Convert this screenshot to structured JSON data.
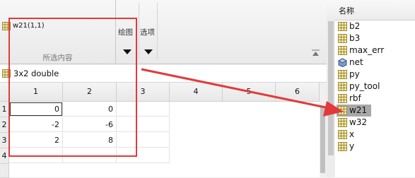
{
  "ribbon": {
    "selection_name": "w21(1,1)",
    "selection_caption": "所选内容",
    "plot_label": "绘图",
    "options_label": "选项"
  },
  "variable_info": {
    "size_type": "3x2 double"
  },
  "grid": {
    "column_headers": [
      "1",
      "2",
      "3",
      "4",
      "5",
      "6"
    ],
    "row_headers": [
      "1",
      "2",
      "3",
      "4"
    ],
    "rows": [
      [
        "0",
        "0"
      ],
      [
        "-2",
        "-6"
      ],
      [
        "2",
        "8"
      ],
      [
        "",
        ""
      ]
    ]
  },
  "workspace": {
    "header_label": "名称",
    "variables": [
      {
        "name": "b2",
        "icon": "matrix-icon"
      },
      {
        "name": "b3",
        "icon": "matrix-icon"
      },
      {
        "name": "max_err",
        "icon": "matrix-icon"
      },
      {
        "name": "net",
        "icon": "network-object-icon"
      },
      {
        "name": "py",
        "icon": "matrix-icon"
      },
      {
        "name": "py_tool",
        "icon": "matrix-icon"
      },
      {
        "name": "rbf",
        "icon": "matrix-icon"
      },
      {
        "name": "w21",
        "icon": "matrix-icon",
        "selected": true
      },
      {
        "name": "w32",
        "icon": "matrix-icon"
      },
      {
        "name": "x",
        "icon": "matrix-icon"
      },
      {
        "name": "y",
        "icon": "matrix-icon"
      }
    ]
  },
  "colors": {
    "annotation": "#e23a3a",
    "selected_row": "#a8a8a8",
    "icon_fill": "#f6e9a8",
    "icon_border": "#9a8a3a"
  }
}
